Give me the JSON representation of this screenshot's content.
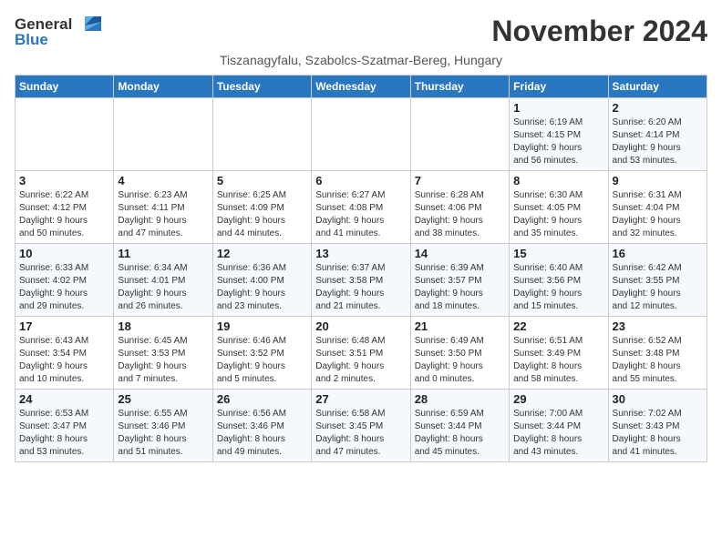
{
  "header": {
    "logo_general": "General",
    "logo_blue": "Blue",
    "month_title": "November 2024",
    "subtitle": "Tiszanagyfalu, Szabolcs-Szatmar-Bereg, Hungary"
  },
  "weekdays": [
    "Sunday",
    "Monday",
    "Tuesday",
    "Wednesday",
    "Thursday",
    "Friday",
    "Saturday"
  ],
  "weeks": [
    [
      {
        "day": "",
        "info": ""
      },
      {
        "day": "",
        "info": ""
      },
      {
        "day": "",
        "info": ""
      },
      {
        "day": "",
        "info": ""
      },
      {
        "day": "",
        "info": ""
      },
      {
        "day": "1",
        "info": "Sunrise: 6:19 AM\nSunset: 4:15 PM\nDaylight: 9 hours\nand 56 minutes."
      },
      {
        "day": "2",
        "info": "Sunrise: 6:20 AM\nSunset: 4:14 PM\nDaylight: 9 hours\nand 53 minutes."
      }
    ],
    [
      {
        "day": "3",
        "info": "Sunrise: 6:22 AM\nSunset: 4:12 PM\nDaylight: 9 hours\nand 50 minutes."
      },
      {
        "day": "4",
        "info": "Sunrise: 6:23 AM\nSunset: 4:11 PM\nDaylight: 9 hours\nand 47 minutes."
      },
      {
        "day": "5",
        "info": "Sunrise: 6:25 AM\nSunset: 4:09 PM\nDaylight: 9 hours\nand 44 minutes."
      },
      {
        "day": "6",
        "info": "Sunrise: 6:27 AM\nSunset: 4:08 PM\nDaylight: 9 hours\nand 41 minutes."
      },
      {
        "day": "7",
        "info": "Sunrise: 6:28 AM\nSunset: 4:06 PM\nDaylight: 9 hours\nand 38 minutes."
      },
      {
        "day": "8",
        "info": "Sunrise: 6:30 AM\nSunset: 4:05 PM\nDaylight: 9 hours\nand 35 minutes."
      },
      {
        "day": "9",
        "info": "Sunrise: 6:31 AM\nSunset: 4:04 PM\nDaylight: 9 hours\nand 32 minutes."
      }
    ],
    [
      {
        "day": "10",
        "info": "Sunrise: 6:33 AM\nSunset: 4:02 PM\nDaylight: 9 hours\nand 29 minutes."
      },
      {
        "day": "11",
        "info": "Sunrise: 6:34 AM\nSunset: 4:01 PM\nDaylight: 9 hours\nand 26 minutes."
      },
      {
        "day": "12",
        "info": "Sunrise: 6:36 AM\nSunset: 4:00 PM\nDaylight: 9 hours\nand 23 minutes."
      },
      {
        "day": "13",
        "info": "Sunrise: 6:37 AM\nSunset: 3:58 PM\nDaylight: 9 hours\nand 21 minutes."
      },
      {
        "day": "14",
        "info": "Sunrise: 6:39 AM\nSunset: 3:57 PM\nDaylight: 9 hours\nand 18 minutes."
      },
      {
        "day": "15",
        "info": "Sunrise: 6:40 AM\nSunset: 3:56 PM\nDaylight: 9 hours\nand 15 minutes."
      },
      {
        "day": "16",
        "info": "Sunrise: 6:42 AM\nSunset: 3:55 PM\nDaylight: 9 hours\nand 12 minutes."
      }
    ],
    [
      {
        "day": "17",
        "info": "Sunrise: 6:43 AM\nSunset: 3:54 PM\nDaylight: 9 hours\nand 10 minutes."
      },
      {
        "day": "18",
        "info": "Sunrise: 6:45 AM\nSunset: 3:53 PM\nDaylight: 9 hours\nand 7 minutes."
      },
      {
        "day": "19",
        "info": "Sunrise: 6:46 AM\nSunset: 3:52 PM\nDaylight: 9 hours\nand 5 minutes."
      },
      {
        "day": "20",
        "info": "Sunrise: 6:48 AM\nSunset: 3:51 PM\nDaylight: 9 hours\nand 2 minutes."
      },
      {
        "day": "21",
        "info": "Sunrise: 6:49 AM\nSunset: 3:50 PM\nDaylight: 9 hours\nand 0 minutes."
      },
      {
        "day": "22",
        "info": "Sunrise: 6:51 AM\nSunset: 3:49 PM\nDaylight: 8 hours\nand 58 minutes."
      },
      {
        "day": "23",
        "info": "Sunrise: 6:52 AM\nSunset: 3:48 PM\nDaylight: 8 hours\nand 55 minutes."
      }
    ],
    [
      {
        "day": "24",
        "info": "Sunrise: 6:53 AM\nSunset: 3:47 PM\nDaylight: 8 hours\nand 53 minutes."
      },
      {
        "day": "25",
        "info": "Sunrise: 6:55 AM\nSunset: 3:46 PM\nDaylight: 8 hours\nand 51 minutes."
      },
      {
        "day": "26",
        "info": "Sunrise: 6:56 AM\nSunset: 3:46 PM\nDaylight: 8 hours\nand 49 minutes."
      },
      {
        "day": "27",
        "info": "Sunrise: 6:58 AM\nSunset: 3:45 PM\nDaylight: 8 hours\nand 47 minutes."
      },
      {
        "day": "28",
        "info": "Sunrise: 6:59 AM\nSunset: 3:44 PM\nDaylight: 8 hours\nand 45 minutes."
      },
      {
        "day": "29",
        "info": "Sunrise: 7:00 AM\nSunset: 3:44 PM\nDaylight: 8 hours\nand 43 minutes."
      },
      {
        "day": "30",
        "info": "Sunrise: 7:02 AM\nSunset: 3:43 PM\nDaylight: 8 hours\nand 41 minutes."
      }
    ]
  ]
}
